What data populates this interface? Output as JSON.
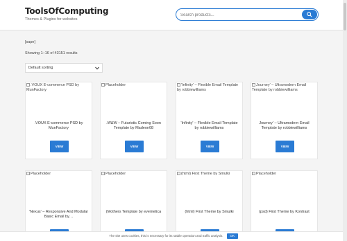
{
  "header": {
    "site_title": "ToolsOfComputing",
    "tagline": "Themes & Plugins for websites",
    "search_placeholder": "Search products..."
  },
  "shop": {
    "breadcrumb": "[sape]",
    "result_count": "Showing 1–16 of 43151 results",
    "sort_selected": "Default sorting"
  },
  "products": [
    {
      "thumb_alt": ".VOUX E-commerce PSD by MunFactory",
      "title": ".VOUX E-commerce PSD by MunFactory",
      "button": "VIEW"
    },
    {
      "thumb_alt": "Placeholder",
      "title": ".W&W – Futuristic Coming Soon Template by Madeon08",
      "button": "VIEW"
    },
    {
      "thumb_alt": "'Infinity' – Flexible Email Template by robbiewilliams",
      "title": "'Infinity' – Flexible Email Template by robbiewilliams",
      "button": "VIEW"
    },
    {
      "thumb_alt": "Journey' – Ultramodern Email Template by robbiewilliams",
      "title": "Journey' – Ultramodern Email Template by robbiewilliams",
      "button": "VIEW"
    },
    {
      "thumb_alt": "Placeholder",
      "title": "'Nexus' – Responsive And Modular Basic Email by…",
      "button": "VIEW"
    },
    {
      "thumb_alt": "Placeholder",
      "title": "(Mothers Template by evemetica",
      "button": "VIEW"
    },
    {
      "thumb_alt": "(html) First Theme by Smulki",
      "title": "(html) First Theme by Smulki",
      "button": "VIEW"
    },
    {
      "thumb_alt": "Placeholder",
      "title": "(psd) First Theme by Kontrast",
      "button": "VIEW"
    }
  ],
  "cookie_notice": {
    "text": "The site uses cookies, this is necessary for its stable operation and traffic analysis.",
    "ok_label": "OK"
  },
  "colors": {
    "accent": "#2a7bd4",
    "background": "#f4f4f4"
  }
}
